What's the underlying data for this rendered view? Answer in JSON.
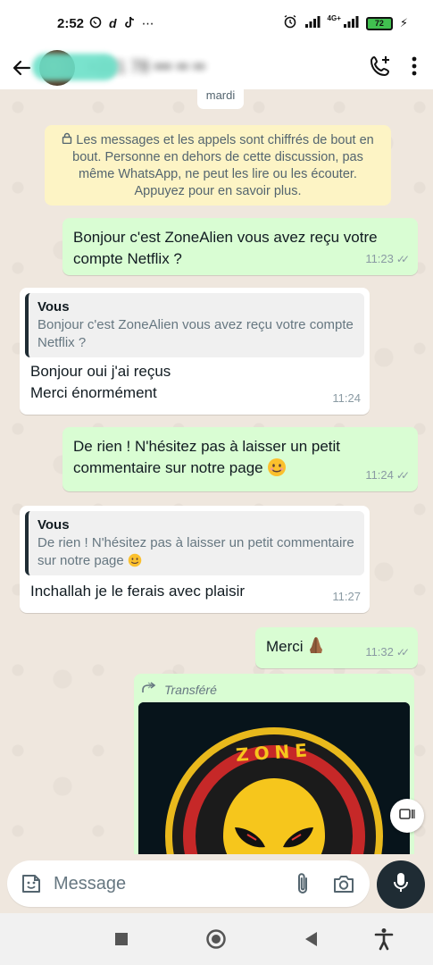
{
  "status_bar": {
    "time": "2:52",
    "battery": "72",
    "network": "4G+"
  },
  "header": {
    "contact_name": "+221 78 ••• •• ••"
  },
  "chat": {
    "date_label": "mardi",
    "encryption_notice": "Les messages et les appels sont chiffrés de bout en bout. Personne en dehors de cette discussion, pas même WhatsApp, ne peut les lire ou les écouter. Appuyez pour en savoir plus.",
    "messages": [
      {
        "direction": "out",
        "text": "Bonjour c'est ZoneAlien vous avez reçu votre compte Netflix ?",
        "time": "11:23"
      },
      {
        "direction": "in",
        "quote_author": "Vous",
        "quote_text": "Bonjour c'est ZoneAlien vous avez reçu votre compte Netflix ?",
        "text_line1": "Bonjour oui j'ai reçus",
        "text_line2": "Merci énormément",
        "time": "11:24"
      },
      {
        "direction": "out",
        "text": "De rien ! N'hésitez pas à laisser un petit commentaire sur notre page",
        "time": "11:24"
      },
      {
        "direction": "in",
        "quote_author": "Vous",
        "quote_text": "De rien ! N'hésitez pas à laisser un petit commentaire sur notre page",
        "text": "Inchallah je le ferais avec plaisir",
        "time": "11:27"
      },
      {
        "direction": "out",
        "text": "Merci",
        "time": "11:32"
      },
      {
        "direction": "out",
        "forwarded_label": "Transféré",
        "media_text": "ZONE"
      }
    ]
  },
  "composer": {
    "placeholder": "Message"
  },
  "colors": {
    "outgoing_bubble": "#d9fdd3",
    "incoming_bubble": "#ffffff",
    "chat_background": "#efe7de",
    "notice_background": "#fdf4c5"
  }
}
